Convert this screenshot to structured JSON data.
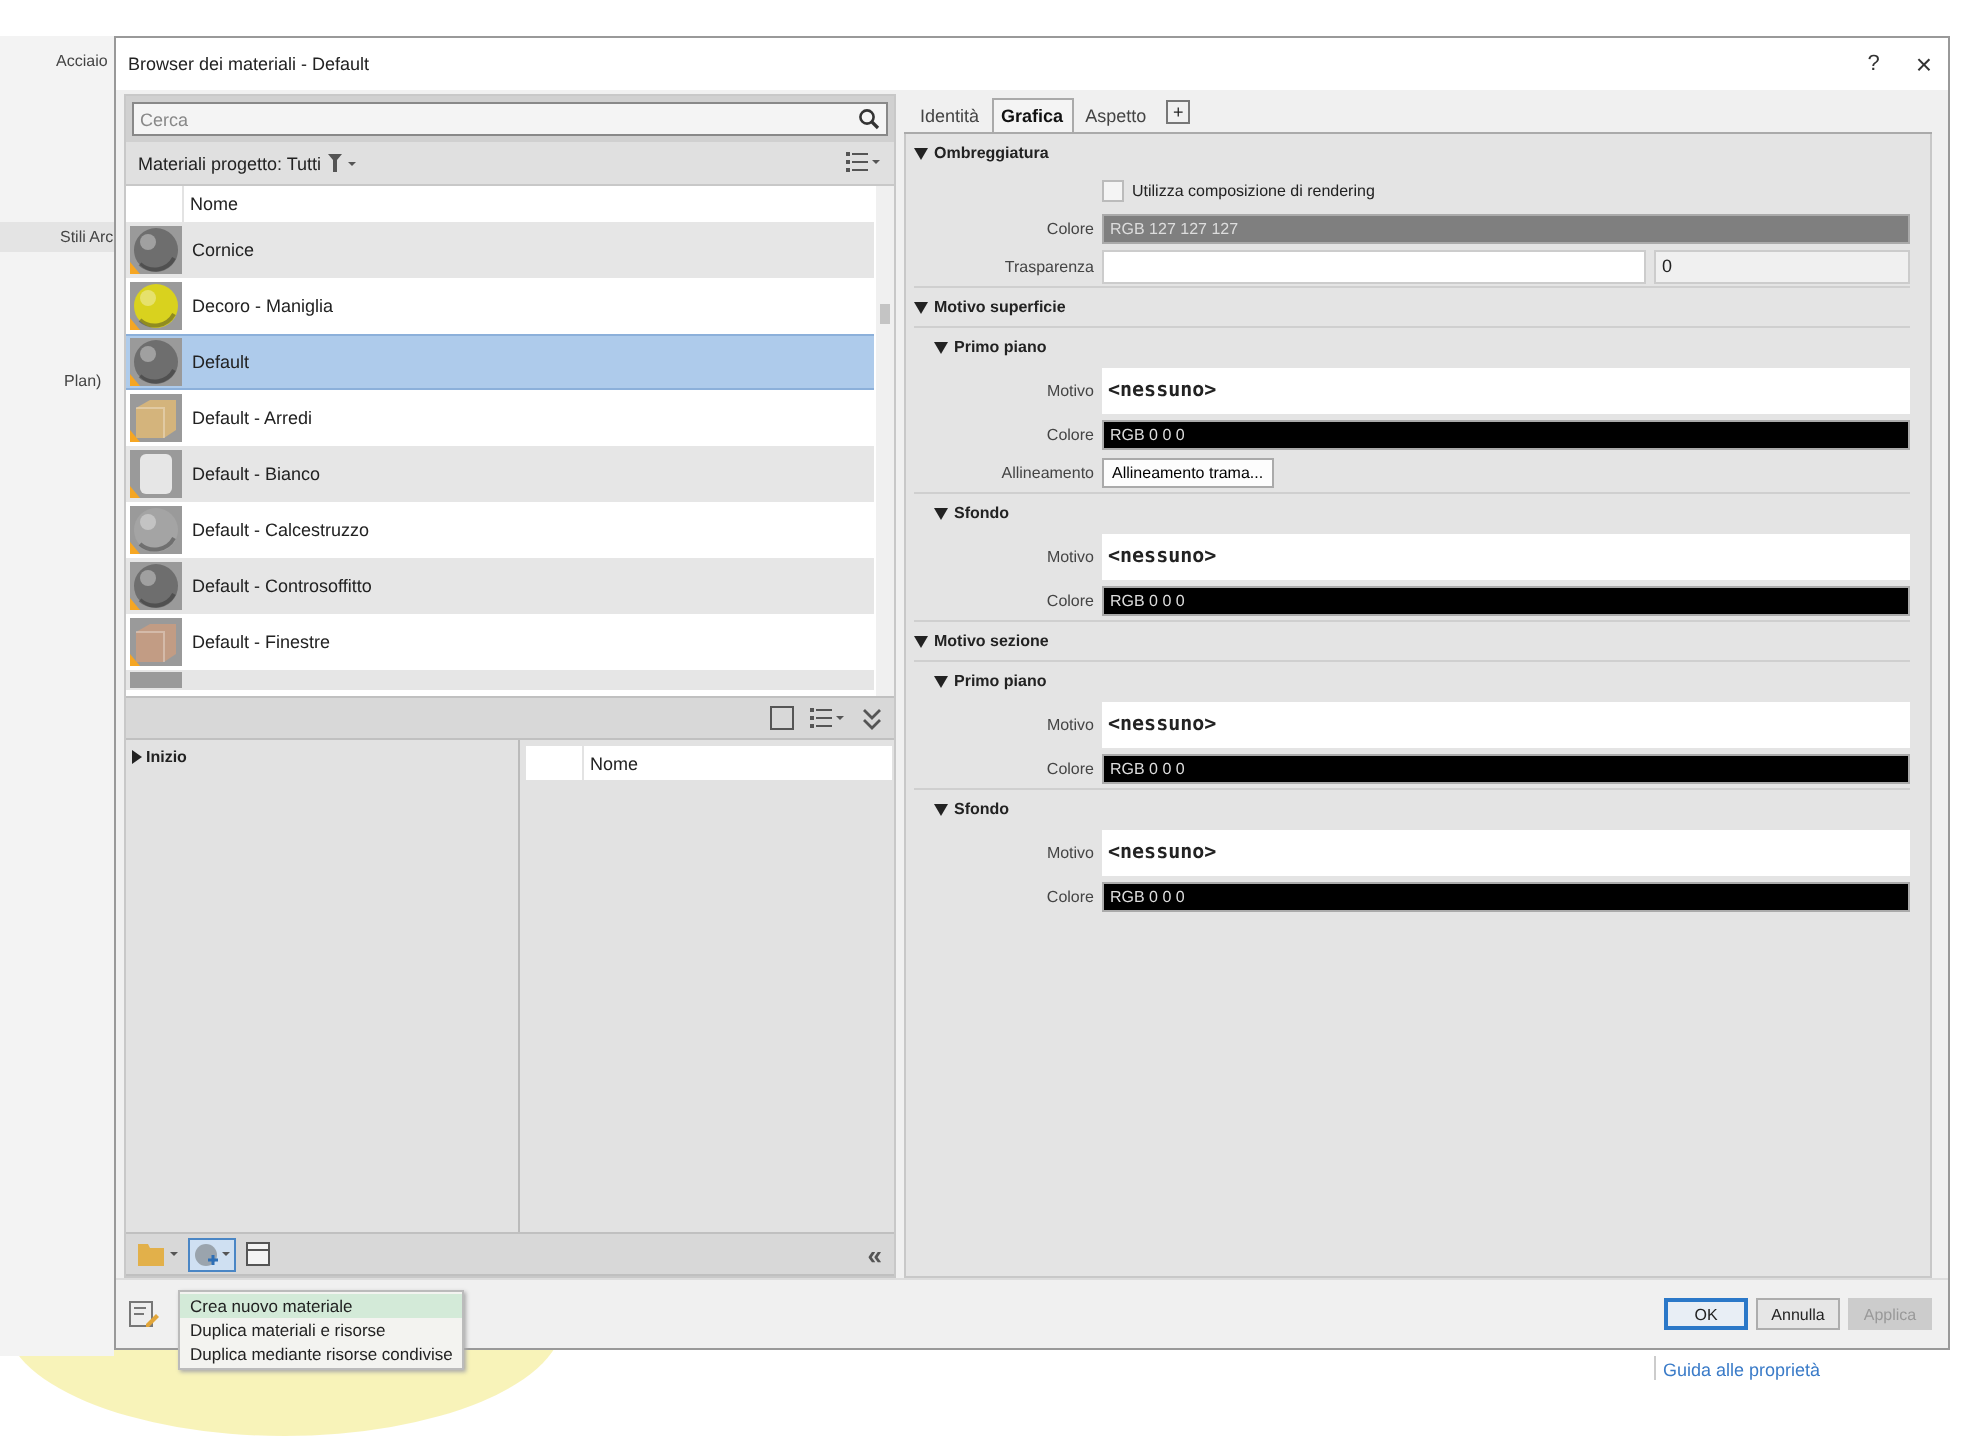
{
  "background_app": {
    "left_labels": [
      "Acciaio",
      "Stili Arc",
      "Plan)"
    ],
    "help_link": "Guida alle proprietà"
  },
  "dialog": {
    "title": "Browser dei materiali - Default",
    "help_button": "?",
    "close_button": "×"
  },
  "search": {
    "placeholder": "Cerca"
  },
  "filter": {
    "label": "Materiali progetto: Tutti"
  },
  "materials": {
    "columns": [
      "Nome"
    ],
    "rows": [
      {
        "name": "Cornice",
        "kind": "sphere",
        "color": "#6e6e6e",
        "selected": false
      },
      {
        "name": "Decoro - Maniglia",
        "kind": "sphere",
        "color": "#d9d21e",
        "selected": false
      },
      {
        "name": "Default",
        "kind": "sphere",
        "color": "#6e6e6e",
        "selected": true
      },
      {
        "name": "Default - Arredi",
        "kind": "cube",
        "color": "#d4b47c",
        "selected": false
      },
      {
        "name": "Default - Bianco",
        "kind": "cylinder",
        "color": "#e6e6e6",
        "selected": false
      },
      {
        "name": "Default - Calcestruzzo",
        "kind": "sphere",
        "color": "#a4a4a4",
        "selected": false
      },
      {
        "name": "Default - Controsoffitto",
        "kind": "sphere",
        "color": "#6e6e6e",
        "selected": false
      },
      {
        "name": "Default - Finestre",
        "kind": "cube",
        "color": "#c29c84",
        "selected": false
      }
    ]
  },
  "library_tree": {
    "items": [
      {
        "label": "Inizio",
        "expanded": false
      }
    ]
  },
  "library_list": {
    "columns": [
      "Nome"
    ]
  },
  "collapse_button": "«",
  "menu": {
    "items": [
      {
        "label": "Crea nuovo materiale",
        "selected": true
      },
      {
        "label": "Duplica materiali e risorse",
        "selected": false
      },
      {
        "label": "Duplica mediante risorse condivise",
        "selected": false
      }
    ]
  },
  "buttons": [
    {
      "label": "OK",
      "default": true,
      "disabled": false
    },
    {
      "label": "Annulla",
      "default": false,
      "disabled": false
    },
    {
      "label": "Applica",
      "default": false,
      "disabled": true
    }
  ],
  "tabs": [
    {
      "label": "Identità",
      "selected": false
    },
    {
      "label": "Grafica",
      "selected": true
    },
    {
      "label": "Aspetto",
      "selected": false
    }
  ],
  "add_tab_button": "+",
  "sections": [
    {
      "title": "Ombreggiatura",
      "expanded": true,
      "rows": [
        {
          "kind": "checkbox",
          "label": "Utilizza composizione di rendering",
          "checked": false
        },
        {
          "kind": "color",
          "label": "Colore",
          "value": "RGB 127 127 127",
          "color": "#7f7f7f"
        },
        {
          "kind": "slider",
          "label": "Trasparenza",
          "level": 0,
          "value": "0"
        }
      ]
    },
    {
      "title": "Motivo superficie",
      "expanded": true,
      "groups": [
        {
          "title": "Primo piano",
          "expanded": true,
          "rows": [
            {
              "kind": "pattern",
              "label": "Motivo",
              "value": "<nessuno>"
            },
            {
              "kind": "color",
              "label": "Colore",
              "value": "RGB 0 0 0",
              "color": "#000000"
            },
            {
              "kind": "button",
              "label": "Allineamento",
              "value": "Allineamento trama..."
            }
          ]
        },
        {
          "title": "Sfondo",
          "expanded": true,
          "rows": [
            {
              "kind": "pattern",
              "label": "Motivo",
              "value": "<nessuno>"
            },
            {
              "kind": "color",
              "label": "Colore",
              "value": "RGB 0 0 0",
              "color": "#000000"
            }
          ]
        }
      ]
    },
    {
      "title": "Motivo sezione",
      "expanded": true,
      "groups": [
        {
          "title": "Primo piano",
          "expanded": true,
          "rows": [
            {
              "kind": "pattern",
              "label": "Motivo",
              "value": "<nessuno>"
            },
            {
              "kind": "color",
              "label": "Colore",
              "value": "RGB 0 0 0",
              "color": "#000000"
            }
          ]
        },
        {
          "title": "Sfondo",
          "expanded": true,
          "rows": [
            {
              "kind": "pattern",
              "label": "Motivo",
              "value": "<nessuno>"
            },
            {
              "kind": "color",
              "label": "Colore",
              "value": "RGB 0 0 0",
              "color": "#000000"
            }
          ]
        }
      ]
    }
  ]
}
